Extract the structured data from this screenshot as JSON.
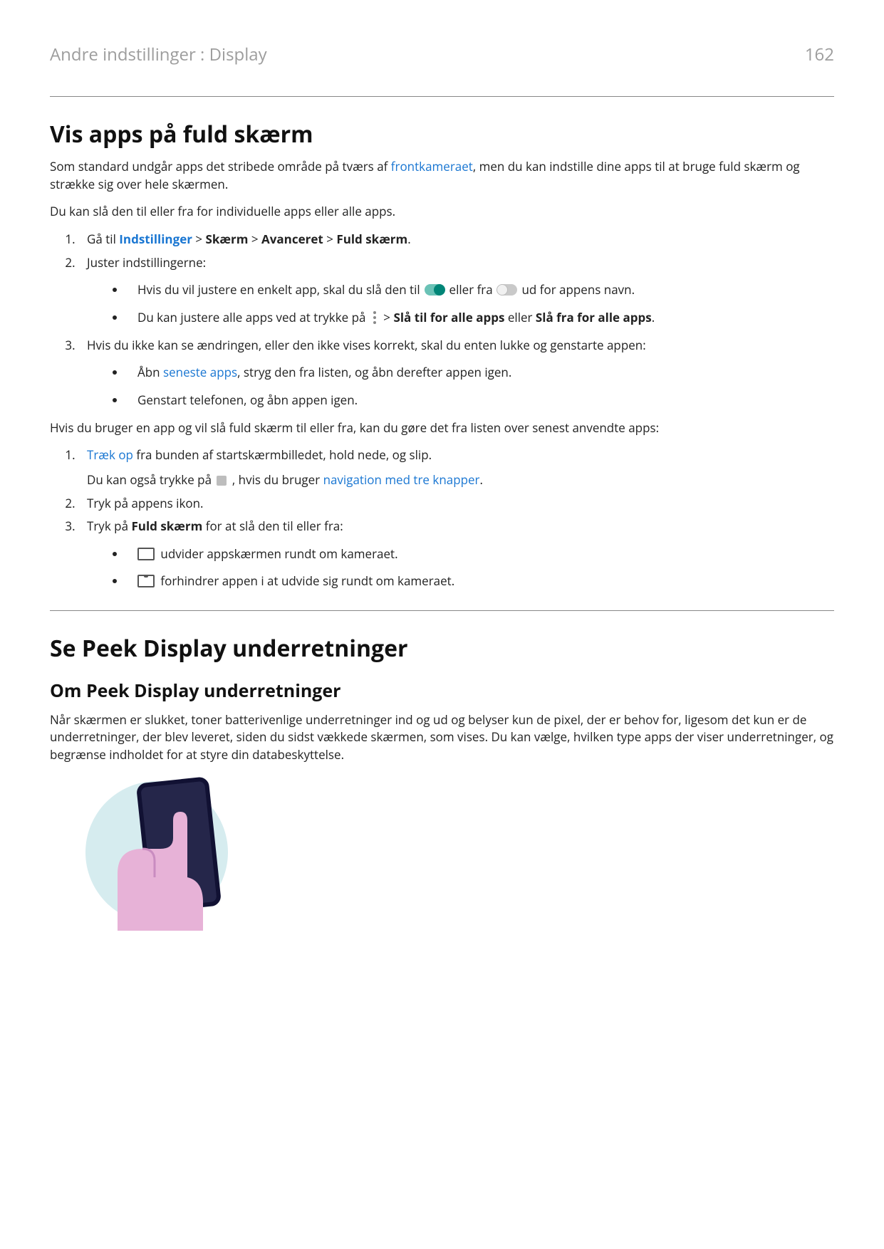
{
  "header": {
    "breadcrumb": "Andre indstillinger : Display",
    "page_number": "162"
  },
  "section1": {
    "title": "Vis apps på fuld skærm",
    "p1_a": "Som standard undgår apps det stribede område på tværs af ",
    "p1_link": "frontkameraet",
    "p1_b": ", men du kan indstille dine apps til at bruge fuld skærm og strække sig over hele skærmen.",
    "p2": "Du kan slå den til eller fra for individuelle apps eller alle apps.",
    "ol1": {
      "i1_a": "Gå til ",
      "i1_link": "Indstillinger",
      "i1_b1": "Skærm",
      "i1_b2": "Avanceret",
      "i1_b3": "Fuld skærm",
      "i1_sep": " > ",
      "i1_end": ".",
      "i2": "Juster indstillingerne:",
      "i2_b1_a": "Hvis du vil justere en enkelt app, skal du slå den til ",
      "i2_b1_b": " eller fra ",
      "i2_b1_c": " ud for appens navn.",
      "i2_b2_a": "Du kan justere alle apps ved at trykke på ",
      "i2_b2_b": " > ",
      "i2_b2_c": "Slå til for alle apps",
      "i2_b2_d": " eller ",
      "i2_b2_e": "Slå fra for alle apps",
      "i2_b2_f": ".",
      "i3": "Hvis du ikke kan se ændringen, eller den ikke vises korrekt, skal du enten lukke og genstarte appen:",
      "i3_b1_a": "Åbn ",
      "i3_b1_link": "seneste apps",
      "i3_b1_b": ", stryg den fra listen, og åbn derefter appen igen.",
      "i3_b2": "Genstart telefonen, og åbn appen igen."
    },
    "p3": "Hvis du bruger en app og vil slå fuld skærm til eller fra, kan du gøre det fra listen over senest anvendte apps:",
    "ol2": {
      "i1_link": "Træk op",
      "i1_a": " fra bunden af startskærmbilledet, hold nede, og slip.",
      "i1_b_a": "Du kan også trykke på ",
      "i1_b_b": " , hvis du bruger ",
      "i1_b_link": "navigation med tre knapper",
      "i1_b_c": ".",
      "i2": "Tryk på appens ikon.",
      "i3_a": "Tryk på ",
      "i3_b": "Fuld skærm",
      "i3_c": " for at slå den til eller fra:",
      "i3_b1": " udvider appskærmen rundt om kameraet.",
      "i3_b2": " forhindrer appen i at udvide sig rundt om kameraet."
    }
  },
  "section2": {
    "title": "Se Peek Display underretninger",
    "subtitle": "Om Peek Display underretninger",
    "p1": "Når skærmen er slukket, toner batterivenlige underretninger ind og ud og belyser kun de pixel, der er behov for, ligesom det kun er de underretninger, der blev leveret, siden du sidst vækkede skærmen, som vises. Du kan vælge, hvilken type apps der viser underretninger, og begrænse indholdet for at styre din databeskyttelse."
  }
}
